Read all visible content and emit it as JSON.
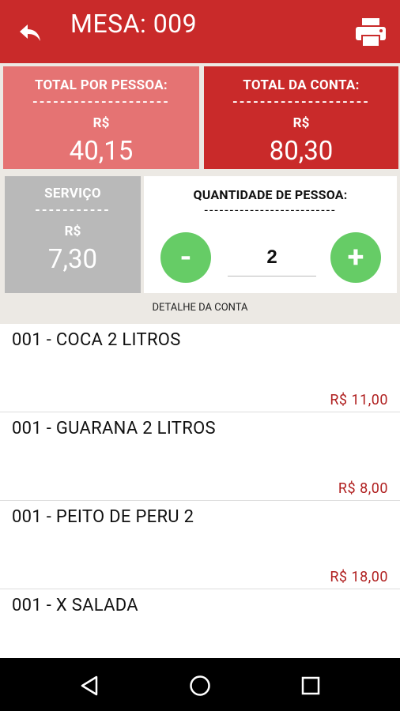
{
  "appbar": {
    "title": "MESA: 009",
    "back_icon": "reply-arrow-icon",
    "print_icon": "printer-icon"
  },
  "summary": {
    "per_person": {
      "label": "TOTAL POR PESSOA:",
      "dashes": "--------------------",
      "currency": "R$",
      "value": "40,15"
    },
    "total": {
      "label": "TOTAL DA CONTA:",
      "dashes": "--------------------",
      "currency": "R$",
      "value": "80,30"
    },
    "service": {
      "label": "SERVIÇO",
      "dashes": "-----------",
      "currency": "R$",
      "value": "7,30"
    }
  },
  "quantity": {
    "title": "QUANTIDADE DE PESSOA:",
    "dashes": "--------------------------",
    "minus_label": "-",
    "plus_label": "+",
    "value": "2"
  },
  "detail_header": "DETALHE DA CONTA",
  "items": [
    {
      "name": "001 - COCA 2 LITROS",
      "price": "R$  11,00"
    },
    {
      "name": "001 - GUARANA 2 LITROS",
      "price": "R$  8,00"
    },
    {
      "name": "001 - PEITO DE PERU 2",
      "price": "R$  18,00"
    },
    {
      "name": "001 - X SALADA",
      "price": ""
    }
  ],
  "colors": {
    "primary": "#c92a2a",
    "per_person_card": "#e57373",
    "service_card": "#b9b9b9",
    "action_green": "#66cc66",
    "price_red": "#b02020"
  },
  "navbar": {
    "back_icon": "nav-back-icon",
    "home_icon": "nav-home-icon",
    "recents_icon": "nav-recents-icon"
  }
}
